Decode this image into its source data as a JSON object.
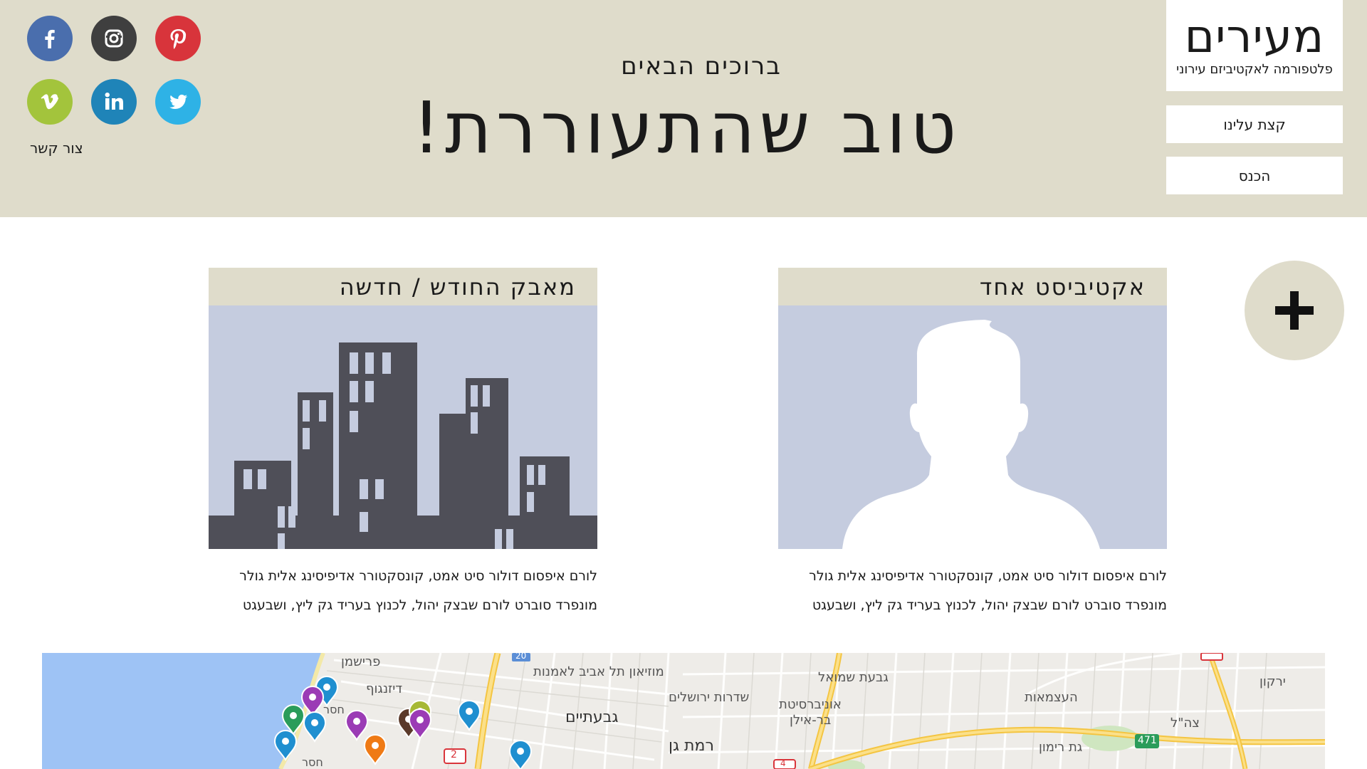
{
  "brand": {
    "name": "מעירים",
    "tagline": "פלטפורמה לאקטיביזם עירוני"
  },
  "nav": {
    "about": "קצת עלינו",
    "login": "הכנס"
  },
  "hero": {
    "subtitle": "ברוכים הבאים",
    "title": "טוב שהתעוררת!"
  },
  "social": {
    "items": [
      {
        "name": "facebook",
        "color": "#4a6ead"
      },
      {
        "name": "instagram",
        "color": "#3f3f3f"
      },
      {
        "name": "pinterest",
        "color": "#d8343b"
      },
      {
        "name": "vimeo",
        "color": "#a3c43c"
      },
      {
        "name": "linkedin",
        "color": "#1f84b8"
      },
      {
        "name": "twitter",
        "color": "#2eb2e6"
      }
    ],
    "contact": "צור קשר"
  },
  "cards": {
    "activist": {
      "title": "אקטיביסט אחד",
      "line1": "לורם איפסום דולור סיט אמט, קונסקטורר אדיפיסינג אלית גולר",
      "line2": "מונפרד סוברט לורם שבצק יהול, לכנוץ בעריד גק ליץ, ושבעגט"
    },
    "struggle": {
      "title": "מאבק החודש / חדשה",
      "line1": "לורם איפסום דולור סיט אמט, קונסקטורר אדיפיסינג אלית גולר",
      "line2": "מונפרד סוברט לורם שבצק יהול, לכנוץ בעריד גק ליץ, ושבעגט"
    }
  },
  "map": {
    "labels": {
      "museum": "מוזיאון תל אביב לאמנות",
      "givatayim": "גבעתיים",
      "ramat_gan": "רמת גן",
      "bar_ilan_1": "אוניברסיטת",
      "bar_ilan_2": "בר-אילן",
      "givat_shmuel": "גבעת שמואל",
      "gat_rimon": "גת רימון",
      "jerusalem_blvd": "שדרות ירושלים",
      "atzmaut": "העצמאות",
      "frishman": "פרישמן",
      "dizengoff": "דיזנגוף",
      "route_2": "2",
      "route_20": "20",
      "route_471": "471",
      "route_4": "4",
      "yarkon": "ירקון",
      "tzahal": "צה\"ל",
      "hosr1": "חסר",
      "hosr2": "חסר"
    },
    "sea_color": "#9ec3f5",
    "pins": [
      {
        "color": "#1f8fd0"
      },
      {
        "color": "#9b3bb5"
      },
      {
        "color": "#2a9c5a"
      },
      {
        "color": "#1f8fd0"
      },
      {
        "color": "#9b3bb5"
      },
      {
        "color": "#5b3a2a"
      },
      {
        "color": "#a7b935"
      },
      {
        "color": "#1f8fd0"
      },
      {
        "color": "#1f8fd0"
      },
      {
        "color": "#ef7a15"
      },
      {
        "color": "#1f8fd0"
      },
      {
        "color": "#9b3bb5"
      }
    ]
  }
}
